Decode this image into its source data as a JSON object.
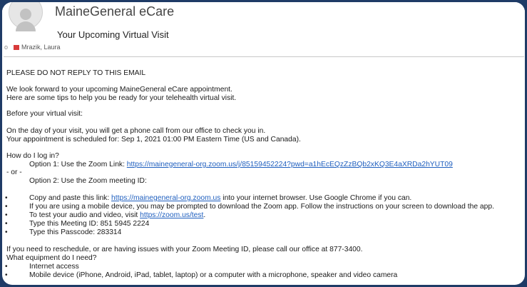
{
  "header": {
    "sender": "MaineGeneral eCare",
    "subject": "Your Upcoming Virtual Visit",
    "recipient": "Mrazik, Laura",
    "side_mark": "o"
  },
  "email": {
    "no_reply": "PLEASE DO NOT REPLY TO THIS EMAIL",
    "intro1": "We look forward to your upcoming MaineGeneral eCare appointment.",
    "intro2": "Here are some tips to help you be ready for your telehealth virtual visit.",
    "before": "Before your virtual visit:",
    "day_of": "On the day of your visit, you will get a phone call from our office to check you in.",
    "scheduled": "Your appointment is scheduled for: Sep 1, 2021 01:00 PM Eastern Time (US and Canada).",
    "login_q": "How do I log in?",
    "option1_text": "Option 1: Use the Zoom Link: ",
    "option1_link": "https://mainegeneral-org.zoom.us/j/85159452224?pwd=a1hEcEQzZzBQb2xKQ3E4aXRDa2hYUT09",
    "or": "- or -",
    "option2": "Option 2: Use the Zoom meeting ID:",
    "bullets": {
      "b1_pre": "Copy and paste this link: ",
      "b1_link": "https://mainegeneral-org.zoom.us",
      "b1_post": " into your internet browser. Use Google Chrome if you can.",
      "b2": "If you are using a mobile device, you may be prompted to download the Zoom app.  Follow the instructions on your screen to download the app.",
      "b3_pre": "To test your audio and video, visit ",
      "b3_link": "https://zoom.us/test",
      "b3_post": ".",
      "b4": "Type this Meeting ID: 851 5945 2224",
      "b5": "Type this Passcode: 283314"
    },
    "reschedule": "If you need to reschedule, or are having issues with your Zoom Meeting ID, please call our office at 877-3400.",
    "equip_q": "What equipment do I need?",
    "equip1": "Internet access",
    "equip2": "Mobile device (iPhone, Android, iPad, tablet, laptop) or a computer with a microphone, speaker and video camera"
  }
}
